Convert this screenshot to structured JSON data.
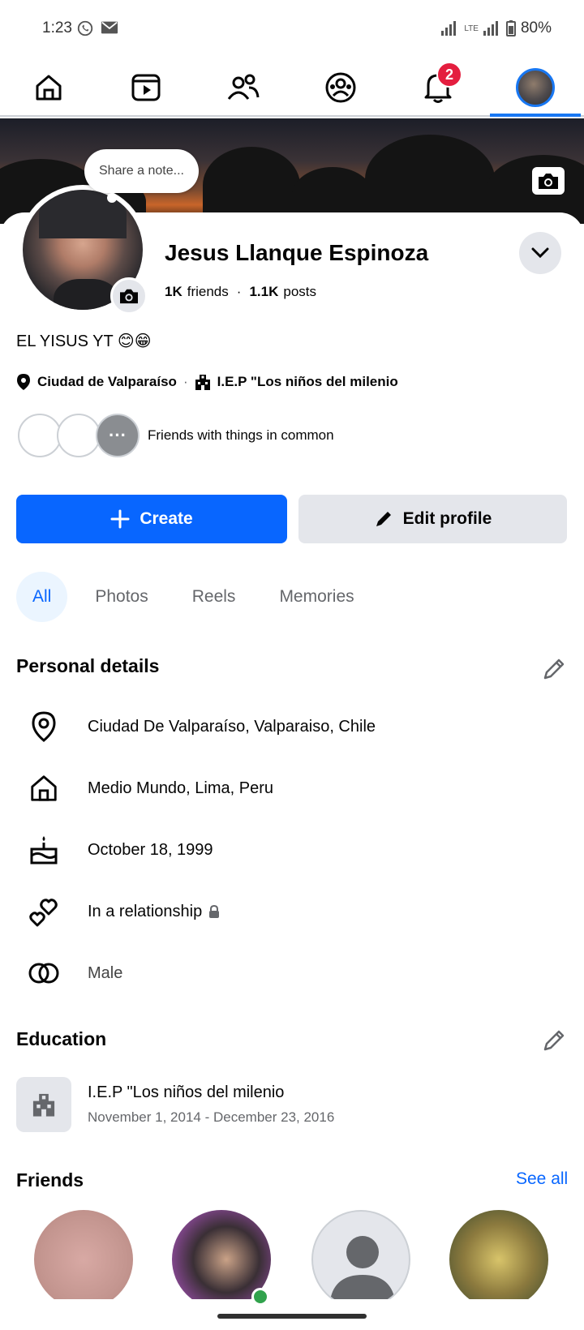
{
  "status_bar": {
    "time": "1:23",
    "battery": "80%",
    "network": "LTE"
  },
  "nav": {
    "items": [
      {
        "name": "home",
        "icon": "home-icon"
      },
      {
        "name": "reels",
        "icon": "video-icon"
      },
      {
        "name": "friends",
        "icon": "friends-icon"
      },
      {
        "name": "groups",
        "icon": "groups-icon"
      },
      {
        "name": "notifications",
        "icon": "bell-icon",
        "badge": "2"
      },
      {
        "name": "profile",
        "icon": "avatar-icon",
        "active": true
      }
    ],
    "notifications_badge": "2"
  },
  "profile": {
    "note_placeholder": "Share a note...",
    "name": "Jesus Llanque Espinoza",
    "friends_count": "1K",
    "friends_label": "friends",
    "posts_count": "1.1K",
    "posts_label": "posts",
    "bio": "EL YISUS YT 😊😁",
    "location": "Ciudad de Valparaíso",
    "school": "I.E.P \"Los niños del milenio",
    "mutual_text": "Friends with things in common"
  },
  "actions": {
    "create_label": "Create",
    "edit_profile_label": "Edit profile"
  },
  "tabs": [
    "All",
    "Photos",
    "Reels",
    "Memories"
  ],
  "personal_details": {
    "title": "Personal details",
    "items": [
      {
        "icon": "location-pin-icon",
        "text": "Ciudad De Valparaíso, Valparaiso, Chile"
      },
      {
        "icon": "home-icon",
        "text": "Medio Mundo, Lima, Peru"
      },
      {
        "icon": "birthday-cake-icon",
        "text": "October 18, 1999"
      },
      {
        "icon": "relationship-hearts-icon",
        "text": "In a relationship"
      },
      {
        "icon": "gender-icon",
        "text": "Male"
      }
    ]
  },
  "education": {
    "title": "Education",
    "school": "I.E.P \"Los niños del milenio",
    "dates": "November 1, 2014 - December 23, 2016"
  },
  "friends": {
    "title": "Friends",
    "see_all": "See all"
  },
  "colors": {
    "accent": "#0866ff",
    "badge": "#e41e3f",
    "secondary_bg": "#e4e6eb",
    "muted_text": "#65676b"
  }
}
